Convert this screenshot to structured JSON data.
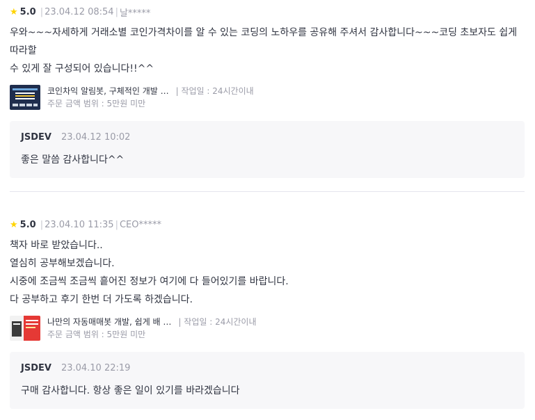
{
  "reviews": [
    {
      "star_icon": "star-icon",
      "rating": "5.0",
      "date": "23.04.12 08:54",
      "author": "날*****",
      "body": [
        "우와~~~자세하게 거래소별 코인가격차이를 알 수 있는 코딩의 노하우를 공유해 주셔서 감사합니다~~~코딩 초보자도 쉽게 따라할",
        "수 있게 잘 구성되어 있습니다!!^^"
      ],
      "product_title": "코인차익 알림봇, 구체적인 개발 …",
      "work_period": "| 작업일 : 24시간이내",
      "price_range": "주문 금액 범위 : 5만원 미만",
      "reply": {
        "name": "JSDEV",
        "date": "23.04.12 10:02",
        "text": "좋은 말씀 감사합니다^^"
      }
    },
    {
      "star_icon": "star-icon",
      "rating": "5.0",
      "date": "23.04.10 11:35",
      "author": "CEO*****",
      "body": [
        "책자 바로 받았습니다..",
        "열심히 공부해보겠습니다.",
        "시중에 조금씩 조금씩 흩어진 정보가 여기에 다 들어있기를 바랍니다.",
        "다 공부하고 후기 한번 더 가도록 하겠습니다."
      ],
      "product_title": "나만의 자동매매봇 개발, 쉽게 배 …",
      "work_period": "| 작업일 : 24시간이내",
      "price_range": "주문 금액 범위 : 5만원 미만",
      "reply": {
        "name": "JSDEV",
        "date": "23.04.10 22:19",
        "text": "구매 감사합니다. 항상 좋은 일이 있기를 바라겠습니다"
      }
    }
  ],
  "colors": {
    "star": "#ffd400",
    "reply_bg": "#f7f7f9",
    "thumb1": "#1f2d4d",
    "thumb2": "#e53935"
  }
}
